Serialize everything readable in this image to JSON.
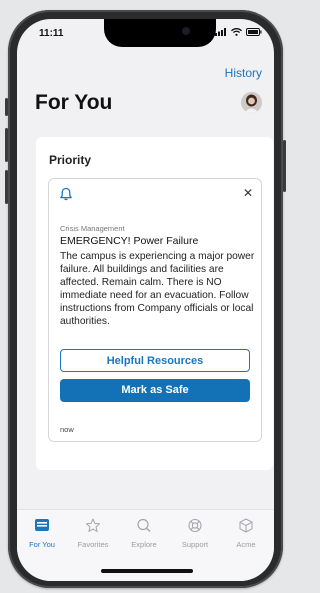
{
  "status_bar": {
    "time": "11:11"
  },
  "header": {
    "history_label": "History",
    "title": "For You"
  },
  "panel": {
    "heading": "Priority"
  },
  "alert": {
    "category": "Crisis Management",
    "headline": "EMERGENCY!  Power Failure",
    "body": "The campus is experiencing a major power failure. All buildings and facilities are affected. Remain calm. There is NO immediate need for an evacuation. Follow instructions from Company officials or local authorities.",
    "helpful_resources_label": "Helpful Resources",
    "mark_safe_label": "Mark as Safe",
    "timestamp": "now"
  },
  "tabs": [
    {
      "label": "For You",
      "icon": "inbox-icon",
      "active": true
    },
    {
      "label": "Favorites",
      "icon": "star-icon",
      "active": false
    },
    {
      "label": "Explore",
      "icon": "search-icon",
      "active": false
    },
    {
      "label": "Support",
      "icon": "lifebuoy-icon",
      "active": false
    },
    {
      "label": "Acme",
      "icon": "cube-icon",
      "active": false
    }
  ],
  "colors": {
    "accent": "#1b76bd",
    "primary_button": "#1272b5",
    "background": "#f1f1f3"
  }
}
